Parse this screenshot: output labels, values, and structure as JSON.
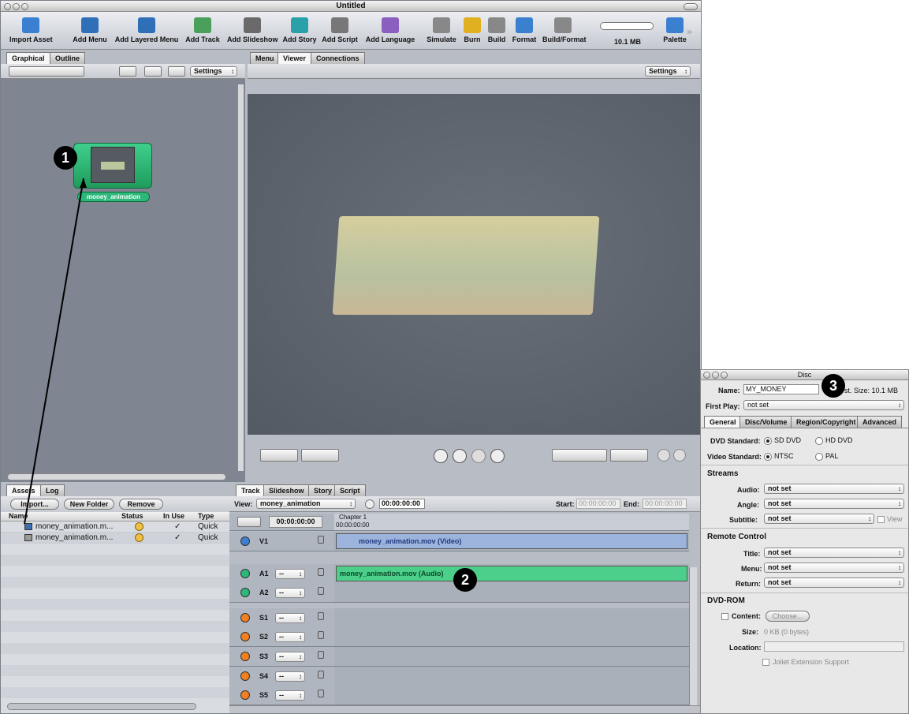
{
  "window": {
    "title": "Untitled"
  },
  "toolbar": {
    "items": [
      {
        "label": "Import Asset",
        "icon": "import-icon",
        "color": "#3b7fd0"
      },
      {
        "label": "Add Menu",
        "icon": "menu-icon",
        "color": "#2f6fb8"
      },
      {
        "label": "Add Layered Menu",
        "icon": "layered-menu-icon",
        "color": "#2f6fb8"
      },
      {
        "label": "Add Track",
        "icon": "track-icon",
        "color": "#4a9f5a"
      },
      {
        "label": "Add Slideshow",
        "icon": "slideshow-icon",
        "color": "#6a6a6a"
      },
      {
        "label": "Add Story",
        "icon": "story-icon",
        "color": "#2aa0a8"
      },
      {
        "label": "Add Script",
        "icon": "script-icon",
        "color": "#777"
      },
      {
        "label": "Add Language",
        "icon": "language-icon",
        "color": "#8b5fc0"
      },
      {
        "label": "Simulate",
        "icon": "simulate-icon",
        "color": "#888"
      },
      {
        "label": "Burn",
        "icon": "burn-icon",
        "color": "#e0b020"
      },
      {
        "label": "Build",
        "icon": "build-icon",
        "color": "#888"
      },
      {
        "label": "Format",
        "icon": "format-icon",
        "color": "#3b7fd0"
      },
      {
        "label": "Build/Format",
        "icon": "build-format-icon",
        "color": "#888"
      }
    ],
    "size_label": "10.1 MB",
    "palette_label": "Palette"
  },
  "left_tabs": [
    "Graphical",
    "Outline"
  ],
  "left_settings": "Settings",
  "center_tabs": [
    "Menu",
    "Viewer",
    "Connections"
  ],
  "viewer_settings": "Settings",
  "graphical": {
    "item_label": "money_animation"
  },
  "assets": {
    "tabs": [
      "Assets",
      "Log"
    ],
    "buttons": [
      "Import...",
      "New Folder",
      "Remove"
    ],
    "columns": [
      "Name",
      "Status",
      "In Use",
      "Type"
    ],
    "rows": [
      {
        "name": "money_animation.m...",
        "in_use": "✓",
        "type": "Quick"
      },
      {
        "name": "money_animation.m...",
        "in_use": "✓",
        "type": "Quick"
      }
    ]
  },
  "timeline": {
    "tabs": [
      "Track",
      "Slideshow",
      "Story",
      "Script"
    ],
    "view_label": "View:",
    "view_value": "money_animation",
    "timecode": "00:00:00:00",
    "start_label": "Start:",
    "start_value": "00:00:00:00",
    "end_label": "End:",
    "end_value": "00:00:00:00",
    "ruler_timecode": "00:00:00:00",
    "chapter": "Chapter 1",
    "ruler_time": "00:00:00:00",
    "streams": [
      {
        "id": "V1",
        "clip": "money_animation.mov (Video)"
      },
      {
        "id": "A1",
        "clip": "money_animation.mov (Audio)",
        "popup": "--"
      },
      {
        "id": "A2",
        "clip": "",
        "popup": "--"
      },
      {
        "id": "S1",
        "popup": "--"
      },
      {
        "id": "S2",
        "popup": "--"
      },
      {
        "id": "S3",
        "popup": "--"
      },
      {
        "id": "S4",
        "popup": "--"
      },
      {
        "id": "S5",
        "popup": "--"
      }
    ]
  },
  "callouts": [
    "1",
    "2",
    "3"
  ],
  "disc": {
    "title": "Disc",
    "name_label": "Name:",
    "name_value": "MY_MONEY",
    "est_size": "st. Size: 10.1 MB",
    "first_play_label": "First Play:",
    "first_play_value": "not set",
    "tabs": [
      "General",
      "Disc/Volume",
      "Region/Copyright",
      "Advanced"
    ],
    "dvd_standard_label": "DVD Standard:",
    "dvd_standard_options": [
      "SD DVD",
      "HD DVD"
    ],
    "video_standard_label": "Video Standard:",
    "video_standard_options": [
      "NTSC",
      "PAL"
    ],
    "streams_heading": "Streams",
    "audio_label": "Audio:",
    "angle_label": "Angle:",
    "subtitle_label": "Subtitle:",
    "view_label": "View",
    "remote_heading": "Remote Control",
    "title_label": "Title:",
    "menu_label": "Menu:",
    "return_label": "Return:",
    "not_set": "not set",
    "dvdrom_heading": "DVD-ROM",
    "content_label": "Content:",
    "choose_label": "Choose...",
    "size_label": "Size:",
    "size_value": "0 KB (0 bytes)",
    "location_label": "Location:",
    "joliet_label": "Joliet Extension Support"
  }
}
